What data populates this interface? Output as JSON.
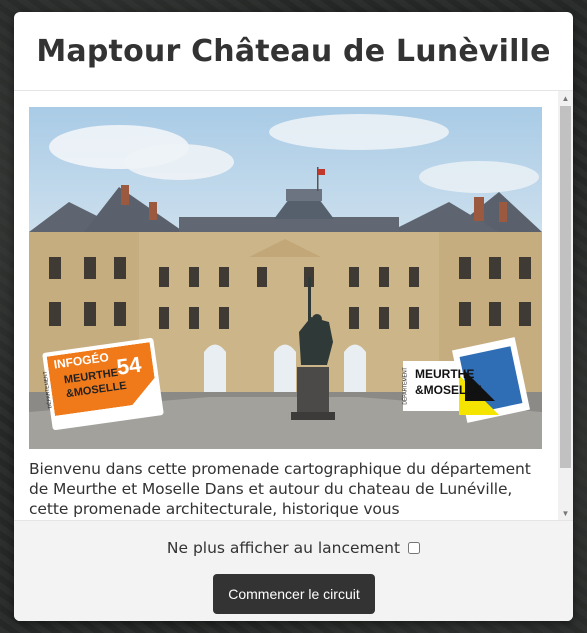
{
  "modal": {
    "title": "Maptour Château de Lunèville",
    "photo": {
      "logo_left": {
        "line1": "INFOGÉO",
        "line2": "MEURTHE",
        "line3": "&MOSELLE",
        "number": "54",
        "side_text": "DÉPARTEMENT"
      },
      "logo_right": {
        "line1": "MEURTHE",
        "line2": "&MOSELLE",
        "side_text": "DÉPARTEMENT"
      }
    },
    "intro_text": "Bienvenu dans cette promenade cartographique du département de Meurthe et Moselle Dans et autour du chateau de Lunéville, cette promenade architecturale, historique vous",
    "footer": {
      "dont_show_label": "Ne plus afficher au lancement",
      "dont_show_checked": false,
      "start_button_label": "Commencer le circuit"
    }
  },
  "colors": {
    "button_bg": "#333333",
    "logo_orange": "#f07a1a",
    "logo_blue": "#2f6db5",
    "logo_yellow": "#f4e400"
  },
  "icons": {
    "scroll_up": "scroll-up-arrow-icon",
    "scroll_down": "scroll-down-arrow-icon"
  }
}
